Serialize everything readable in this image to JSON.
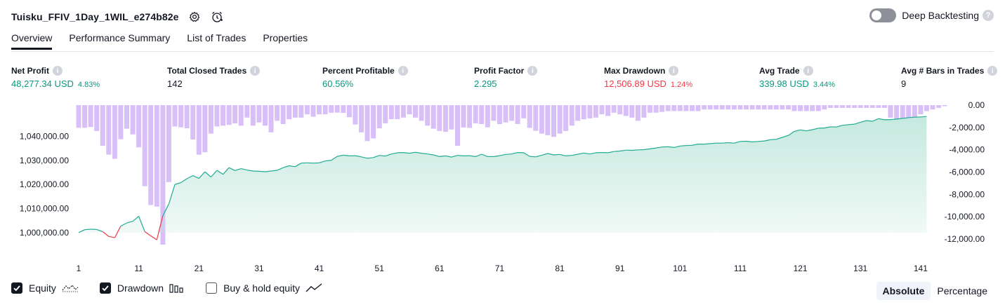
{
  "header": {
    "title": "Tuisku_FFIV_1Day_1WIL_e274b82e",
    "deep_backtesting_label": "Deep Backtesting",
    "help_glyph": "?"
  },
  "tabs": [
    "Overview",
    "Performance Summary",
    "List of Trades",
    "Properties"
  ],
  "active_tab": "Overview",
  "metrics": [
    {
      "label": "Net Profit",
      "value": "48,277.34 USD",
      "pct": "4.83%",
      "color": "green"
    },
    {
      "label": "Total Closed Trades",
      "value": "142",
      "pct": "",
      "color": "dark"
    },
    {
      "label": "Percent Profitable",
      "value": "60.56%",
      "pct": "",
      "color": "green"
    },
    {
      "label": "Profit Factor",
      "value": "2.295",
      "pct": "",
      "color": "green"
    },
    {
      "label": "Max Drawdown",
      "value": "12,506.89 USD",
      "pct": "1.24%",
      "color": "red"
    },
    {
      "label": "Avg Trade",
      "value": "339.98 USD",
      "pct": "3.44%",
      "color": "green"
    },
    {
      "label": "Avg # Bars in Trades",
      "value": "9",
      "pct": "",
      "color": "dark"
    }
  ],
  "info_glyph": "i",
  "legend": {
    "equity": "Equity",
    "drawdown": "Drawdown",
    "buy_hold": "Buy & hold equity"
  },
  "modes": {
    "absolute": "Absolute",
    "percentage": "Percentage"
  },
  "icons": {
    "settings": "gear-icon",
    "alert": "alert-clock-icon"
  },
  "colors": {
    "equity_line": "#22ab94",
    "equity_loss": "#f23645",
    "equity_fill": "#c5e9df",
    "drawdown_bar": "#d8bff8",
    "text": "#131722"
  },
  "chart_data": {
    "type": "area",
    "x_ticks": [
      1,
      11,
      21,
      31,
      41,
      51,
      61,
      71,
      81,
      91,
      101,
      111,
      121,
      131,
      141
    ],
    "xlim": [
      1,
      143
    ],
    "left_axis": {
      "ticks": [
        "1,000,000.00",
        "1,010,000.00",
        "1,020,000.00",
        "1,030,000.00",
        "1,040,000.00"
      ],
      "ylim": [
        995000,
        1053000
      ]
    },
    "right_axis": {
      "ticks": [
        "0.00",
        "-2,000.00",
        "-4,000.00",
        "-6,000.00",
        "-8,000.00",
        "-10,000.00",
        "-12,000.00"
      ],
      "ylim": [
        -12506.89,
        0
      ]
    },
    "series": [
      {
        "name": "Equity",
        "kind": "line",
        "values": [
          1000000,
          1001200,
          1001400,
          1001300,
          1000400,
          998400,
          997900,
          1002700,
          1004000,
          1004700,
          1006800,
          1000400,
          998600,
          997000,
          1007000,
          1012000,
          1020000,
          1020800,
          1022400,
          1023700,
          1022500,
          1025300,
          1023100,
          1025900,
          1024200,
          1027000,
          1025800,
          1026600,
          1026000,
          1025600,
          1025500,
          1025300,
          1025600,
          1025900,
          1027000,
          1027800,
          1027400,
          1028900,
          1029000,
          1028900,
          1029000,
          1029800,
          1030100,
          1031700,
          1032200,
          1031900,
          1032000,
          1031500,
          1030900,
          1031200,
          1032100,
          1031800,
          1032700,
          1033200,
          1033300,
          1033000,
          1033400,
          1033000,
          1032700,
          1032300,
          1031600,
          1031900,
          1031400,
          1032100,
          1031900,
          1032000,
          1031600,
          1032600,
          1031600,
          1031600,
          1032000,
          1032500,
          1032700,
          1033300,
          1033200,
          1031700,
          1031500,
          1032200,
          1032900,
          1032300,
          1032500,
          1031900,
          1032100,
          1032600,
          1033100,
          1032700,
          1033200,
          1033300,
          1033200,
          1033700,
          1033900,
          1034300,
          1034200,
          1034400,
          1034500,
          1034800,
          1035200,
          1035600,
          1035700,
          1035400,
          1036000,
          1036200,
          1036300,
          1036800,
          1036800,
          1037000,
          1037200,
          1037200,
          1037400,
          1037200,
          1037900,
          1038000,
          1037700,
          1037900,
          1038100,
          1038600,
          1038800,
          1039600,
          1040400,
          1042100,
          1042700,
          1042300,
          1042800,
          1043400,
          1043500,
          1044000,
          1043900,
          1044600,
          1044900,
          1045100,
          1045900,
          1046600,
          1046300,
          1047400,
          1046900,
          1047000,
          1047200,
          1047500,
          1047800,
          1048000,
          1048100,
          1048277
        ]
      },
      {
        "name": "Drawdown",
        "kind": "bar",
        "values": [
          -2031,
          -2031,
          -1958,
          -2321,
          -3645,
          -4444,
          -4808,
          -3058,
          -2113,
          -2622,
          -3785,
          -7271,
          -8957,
          -9101,
          -12507,
          -6899,
          -1916,
          -1989,
          -2076,
          -3080,
          -4444,
          -4226,
          -2549,
          -1916,
          -1843,
          -1771,
          -1625,
          -1843,
          -1116,
          -1843,
          -1552,
          -1843,
          -2440,
          -1407,
          -1698,
          -1262,
          -1116,
          -1116,
          -824,
          -1034,
          -824,
          -824,
          -688,
          -670,
          -689,
          -1080,
          -1734,
          -2440,
          -3226,
          -2983,
          -2076,
          -1625,
          -1262,
          -1262,
          -1116,
          -824,
          -1116,
          -1407,
          -1843,
          -2112,
          -2321,
          -2397,
          -2186,
          -3645,
          -2003,
          -2040,
          -1625,
          -1696,
          -1989,
          -1407,
          -1698,
          -1552,
          -1407,
          -1698,
          -1189,
          -2040,
          -2301,
          -2549,
          -2694,
          -2840,
          -2549,
          -2321,
          -1843,
          -1407,
          -1262,
          -1189,
          -1116,
          -824,
          -970,
          -679,
          -824,
          -970,
          -1116,
          -1407,
          -1116,
          -679,
          -679,
          -606,
          -534,
          -534,
          -534,
          -534,
          -534,
          -534,
          -389,
          -389,
          -389,
          -389,
          -389,
          -389,
          -389,
          -389,
          -389,
          -389,
          -389,
          -389,
          -389,
          -389,
          -389,
          -534,
          -534,
          -534,
          -534,
          -534,
          -389,
          -243,
          -243,
          -243,
          -243,
          -243,
          -243,
          -243,
          -243,
          -243,
          -243,
          -1116,
          -1262,
          -1407,
          -1262,
          -1116,
          -824,
          -534,
          -389,
          -243,
          -97,
          0
        ]
      }
    ]
  }
}
